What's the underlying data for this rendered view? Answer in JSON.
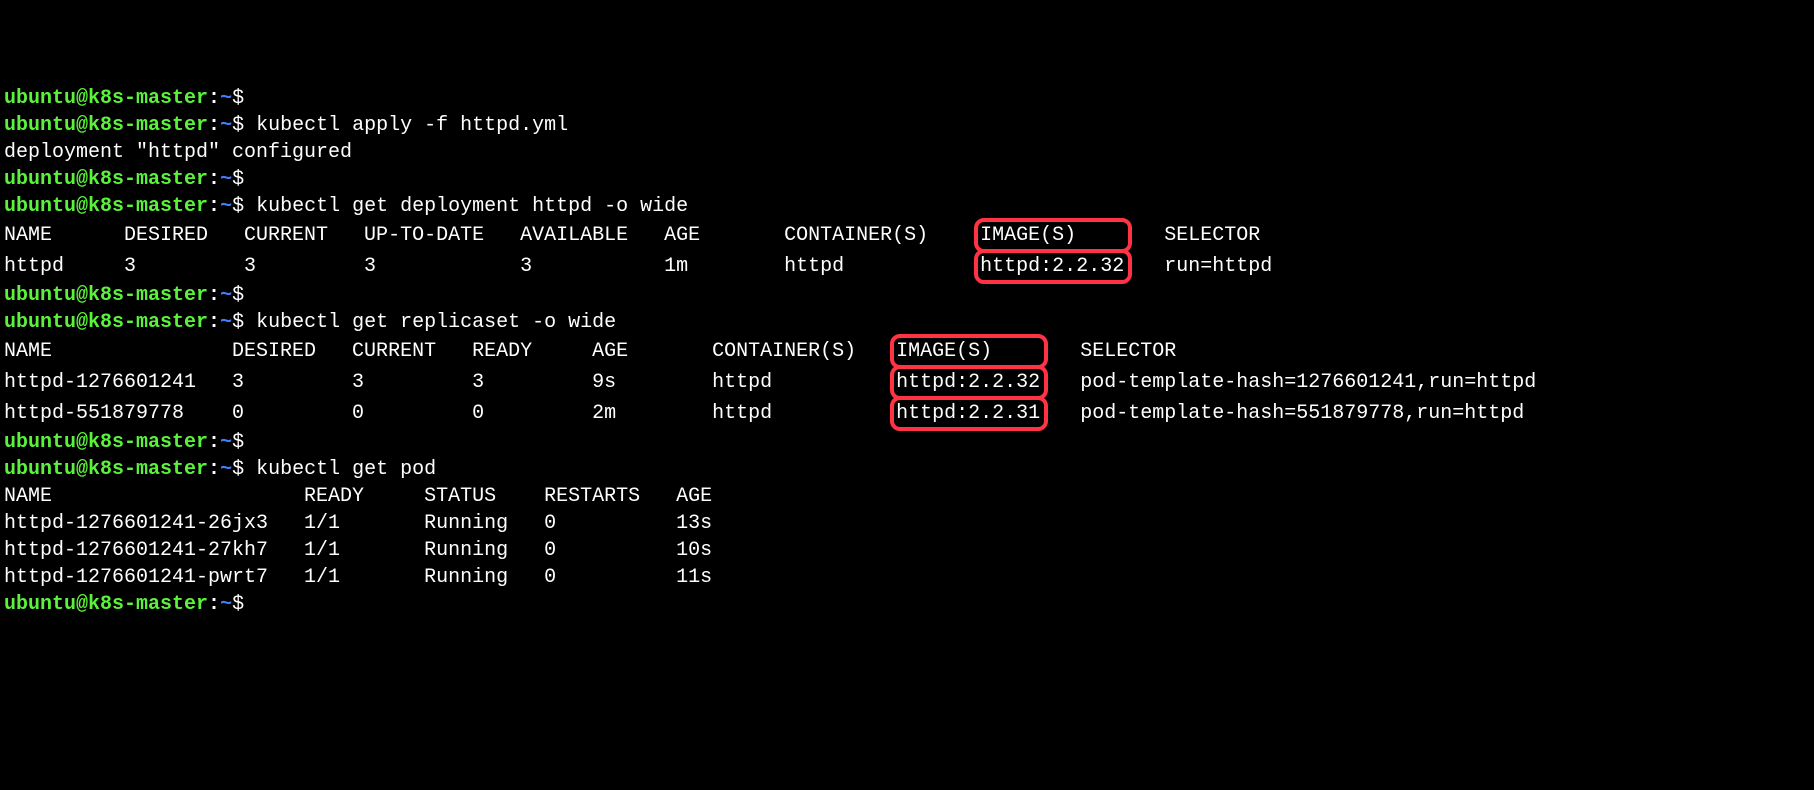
{
  "prompt": {
    "user": "ubuntu@k8s-master",
    "path": "~",
    "dollar": "$ "
  },
  "lines": {
    "cmd1": "kubectl apply -f httpd.yml",
    "out1": "deployment \"httpd\" configured",
    "cmd2": "kubectl get deployment httpd -o wide",
    "cmd3": "kubectl get replicaset -o wide",
    "cmd4": "kubectl get pod"
  },
  "deploy": {
    "header_a": "NAME      DESIRED   CURRENT   UP-TO-DATE   AVAILABLE   AGE       CONTAINER(S)    ",
    "header_images": "IMAGE(S)    ",
    "header_b": "   SELECTOR",
    "row_a": "httpd     3         3         3            3           1m        httpd           ",
    "row_image": "httpd:2.2.32",
    "row_b": "   run=httpd"
  },
  "rs": {
    "header_a": "NAME               DESIRED   CURRENT   READY     AGE       CONTAINER(S)   ",
    "header_images": "IMAGE(S)    ",
    "header_b": "   SELECTOR",
    "row1_a": "httpd-1276601241   3         3         3         9s        httpd          ",
    "row1_image": "httpd:2.2.32",
    "row1_b": "   pod-template-hash=1276601241,run=httpd",
    "row2_a": "httpd-551879778    0         0         0         2m        httpd          ",
    "row2_image": "httpd:2.2.31",
    "row2_b": "   pod-template-hash=551879778,run=httpd"
  },
  "pods": {
    "header": "NAME                     READY     STATUS    RESTARTS   AGE",
    "row1": "httpd-1276601241-26jx3   1/1       Running   0          13s",
    "row2": "httpd-1276601241-27kh7   1/1       Running   0          10s",
    "row3": "httpd-1276601241-pwrt7   1/1       Running   0          11s"
  },
  "highlights": {
    "color": "#ff3344",
    "boxes": [
      "deploy IMAGE(S) header+value",
      "replicaset IMAGE(S) header+values"
    ]
  }
}
